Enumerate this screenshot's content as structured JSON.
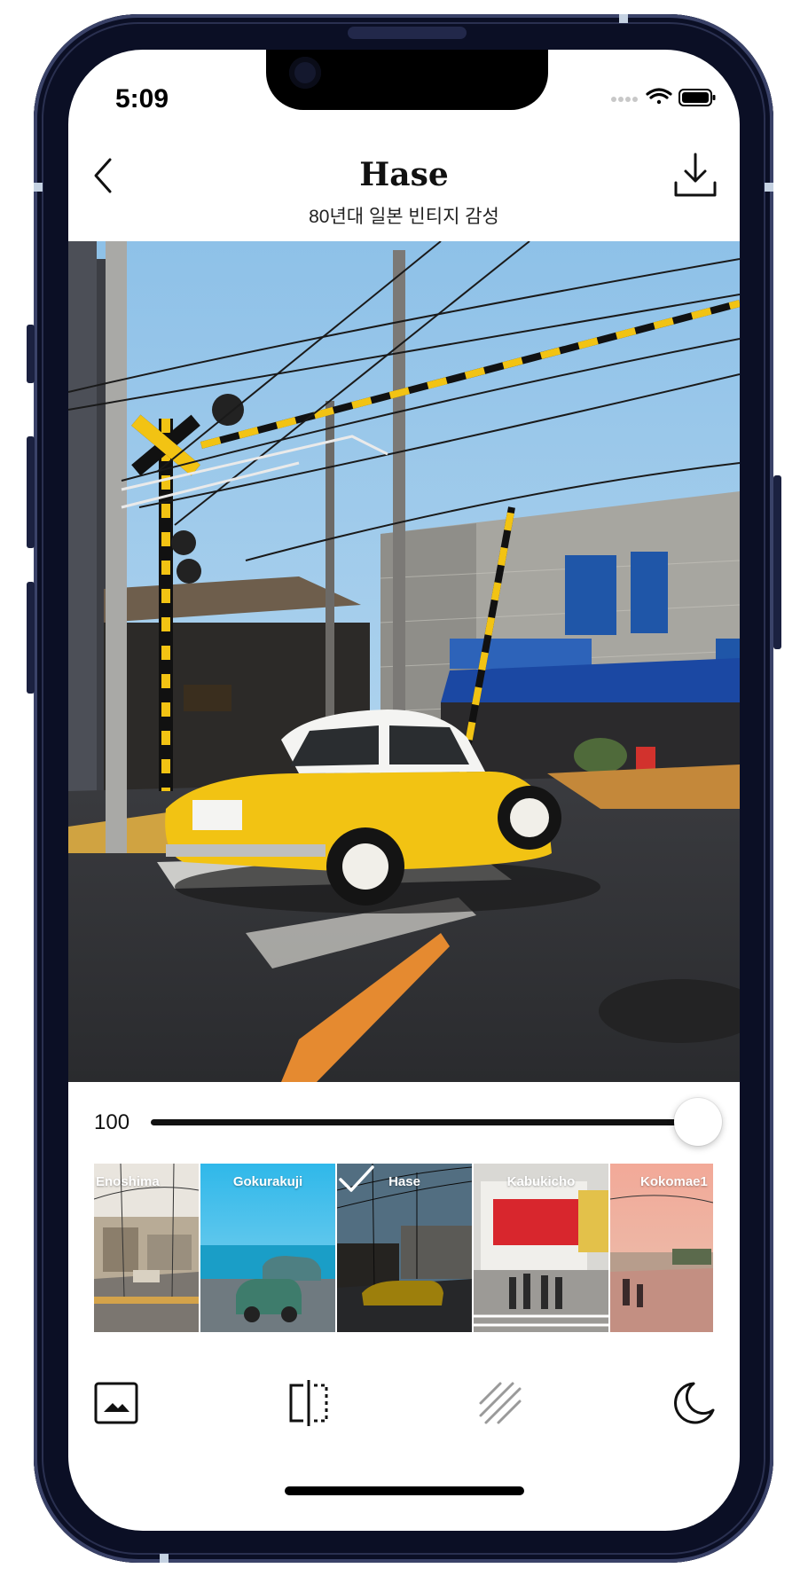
{
  "status_bar": {
    "time": "5:09"
  },
  "header": {
    "title": "Hase",
    "subtitle": "80년대 일본 빈티지 감성"
  },
  "slider": {
    "value": "100",
    "fraction": 1.0
  },
  "filters": [
    {
      "label": "Enoshima",
      "selected": false
    },
    {
      "label": "Gokurakuji",
      "selected": false
    },
    {
      "label": "Hase",
      "selected": true
    },
    {
      "label": "Kabukicho",
      "selected": false
    },
    {
      "label": "Kokomae1",
      "selected": false
    }
  ],
  "toolbar": {
    "items": [
      "image-icon",
      "compare-split-icon",
      "grain-texture-icon",
      "night-moon-icon"
    ]
  },
  "colors": {
    "accent": "#111111",
    "car_yellow": "#f2c313",
    "sky": "#9ec9ea"
  }
}
